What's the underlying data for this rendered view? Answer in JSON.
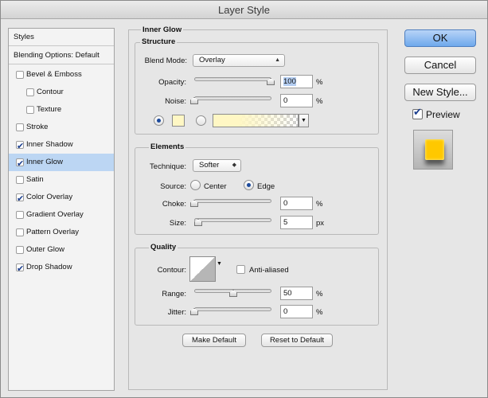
{
  "window": {
    "title": "Layer Style"
  },
  "styles_panel": {
    "header": "Styles",
    "blending": "Blending Options: Default",
    "items": [
      {
        "label": "Bevel & Emboss",
        "checked": false
      },
      {
        "label": "Contour",
        "checked": false
      },
      {
        "label": "Texture",
        "checked": false
      },
      {
        "label": "Stroke",
        "checked": false
      },
      {
        "label": "Inner Shadow",
        "checked": true
      },
      {
        "label": "Inner Glow",
        "checked": true
      },
      {
        "label": "Satin",
        "checked": false
      },
      {
        "label": "Color Overlay",
        "checked": true
      },
      {
        "label": "Gradient Overlay",
        "checked": false
      },
      {
        "label": "Pattern Overlay",
        "checked": false
      },
      {
        "label": "Outer Glow",
        "checked": false
      },
      {
        "label": "Drop Shadow",
        "checked": true
      }
    ]
  },
  "inner_glow": {
    "title": "Inner Glow",
    "structure": {
      "title": "Structure",
      "blend_mode_label": "Blend Mode:",
      "blend_mode_value": "Overlay",
      "opacity_label": "Opacity:",
      "opacity_value": "100",
      "opacity_unit": "%",
      "noise_label": "Noise:",
      "noise_value": "0",
      "noise_unit": "%",
      "glow_color": "#fff7c4"
    },
    "elements": {
      "title": "Elements",
      "technique_label": "Technique:",
      "technique_value": "Softer",
      "source_label": "Source:",
      "source_center": "Center",
      "source_edge": "Edge",
      "choke_label": "Choke:",
      "choke_value": "0",
      "choke_unit": "%",
      "size_label": "Size:",
      "size_value": "5",
      "size_unit": "px"
    },
    "quality": {
      "title": "Quality",
      "contour_label": "Contour:",
      "antialiased_label": "Anti-aliased",
      "range_label": "Range:",
      "range_value": "50",
      "range_unit": "%",
      "jitter_label": "Jitter:",
      "jitter_value": "0",
      "jitter_unit": "%"
    },
    "make_default": "Make Default",
    "reset_default": "Reset to Default"
  },
  "actions": {
    "ok": "OK",
    "cancel": "Cancel",
    "new_style": "New Style...",
    "preview_label": "Preview",
    "preview_checked": true,
    "preview_color": "#ffc800"
  }
}
